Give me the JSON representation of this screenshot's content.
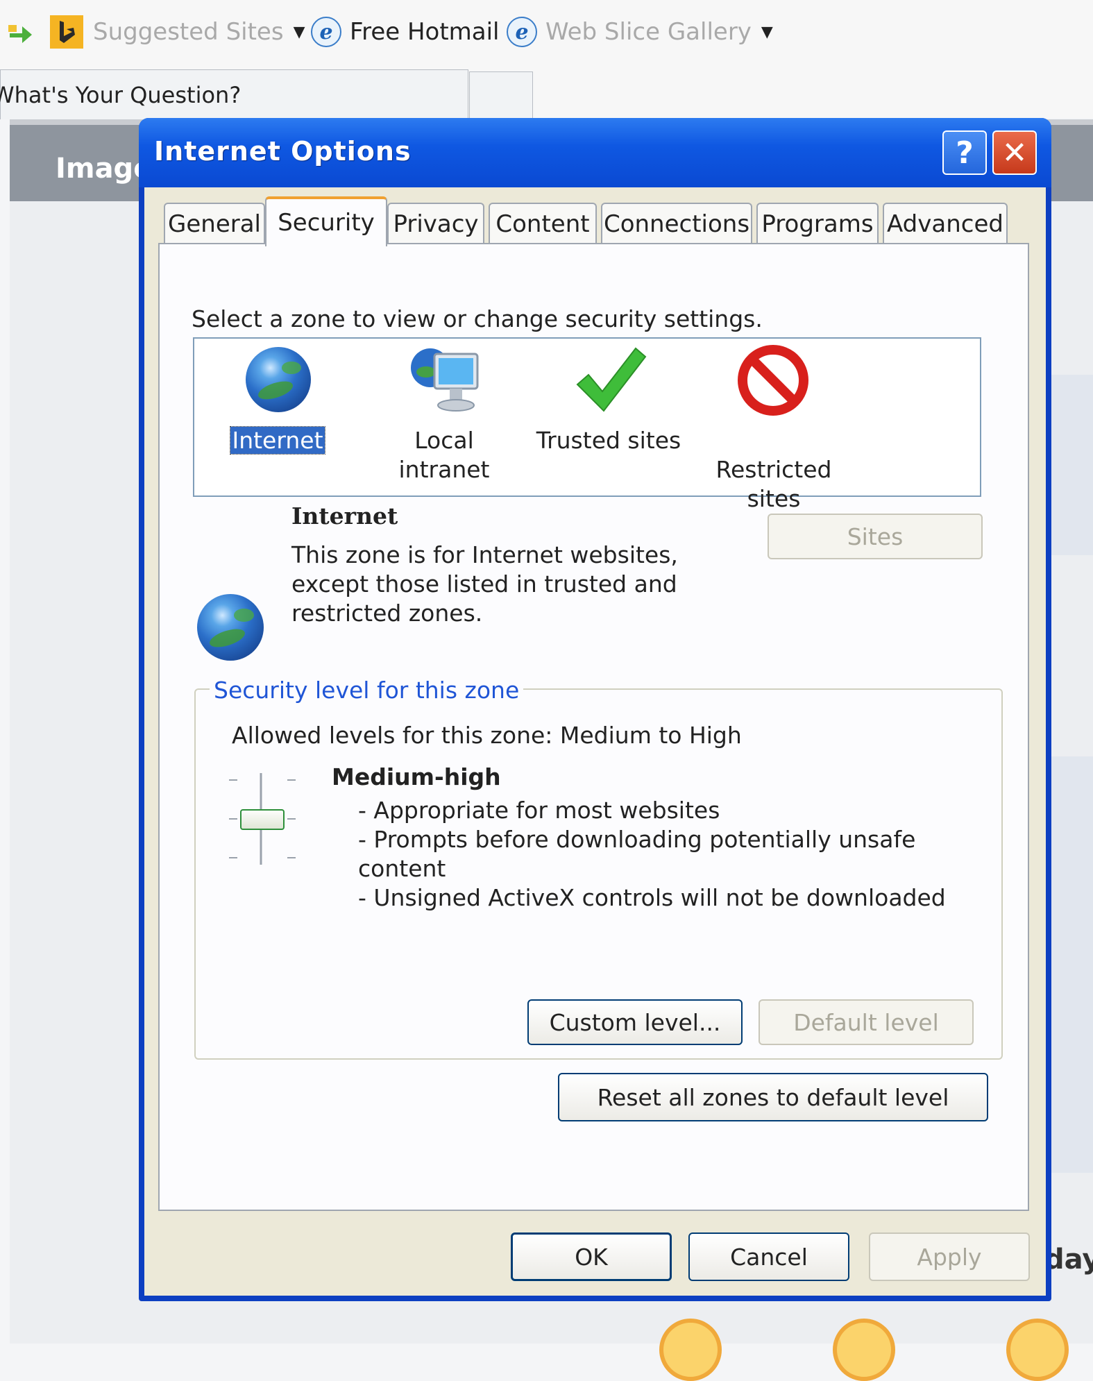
{
  "favorites_bar": {
    "suggested_sites": "Suggested Sites",
    "free_hotmail": "Free Hotmail",
    "web_slice_gallery": "Web Slice Gallery"
  },
  "browser_tabs": {
    "question_tab": "What's Your Question?"
  },
  "background_page": {
    "header_text": "Image",
    "partial_text": "day"
  },
  "dialog": {
    "title": "Internet Options",
    "help_glyph": "?",
    "close_glyph": "✕",
    "tabs": [
      "General",
      "Security",
      "Privacy",
      "Content",
      "Connections",
      "Programs",
      "Advanced"
    ],
    "active_tab": "Security",
    "select_zone_prompt": "Select a zone to view or change security settings.",
    "zones": [
      {
        "label": "Internet",
        "icon": "globe-icon",
        "selected": true
      },
      {
        "label": "Local intranet",
        "icon": "intranet-icon",
        "selected": false
      },
      {
        "label": "Trusted sites",
        "icon": "checkmark-icon",
        "selected": false
      },
      {
        "label": "Restricted\nsites",
        "icon": "restricted-icon",
        "selected": false
      }
    ],
    "zone_info": {
      "title": "Internet",
      "description_line1": "This zone is for Internet websites,",
      "description_line2": "except those listed in trusted and",
      "description_line3": "restricted zones."
    },
    "sites_button": "Sites",
    "security_level": {
      "group_label": "Security level for this zone",
      "allowed_levels": "Allowed levels for this zone: Medium to High",
      "level_name": "Medium-high",
      "bullet1": "- Appropriate for most websites",
      "bullet2a": "- Prompts before downloading potentially unsafe",
      "bullet2b": "content",
      "bullet3": "- Unsigned ActiveX controls will not be downloaded"
    },
    "custom_level_button": "Custom level...",
    "default_level_button": "Default level",
    "reset_all_button": "Reset all zones to default level",
    "ok_button": "OK",
    "cancel_button": "Cancel",
    "apply_button": "Apply"
  },
  "colors": {
    "titlebar_blue": "#0a49d2",
    "dialog_face": "#ece9d8",
    "group_label_blue": "#1f55d6",
    "selection_blue": "#316ac5",
    "close_red": "#c6391b"
  }
}
